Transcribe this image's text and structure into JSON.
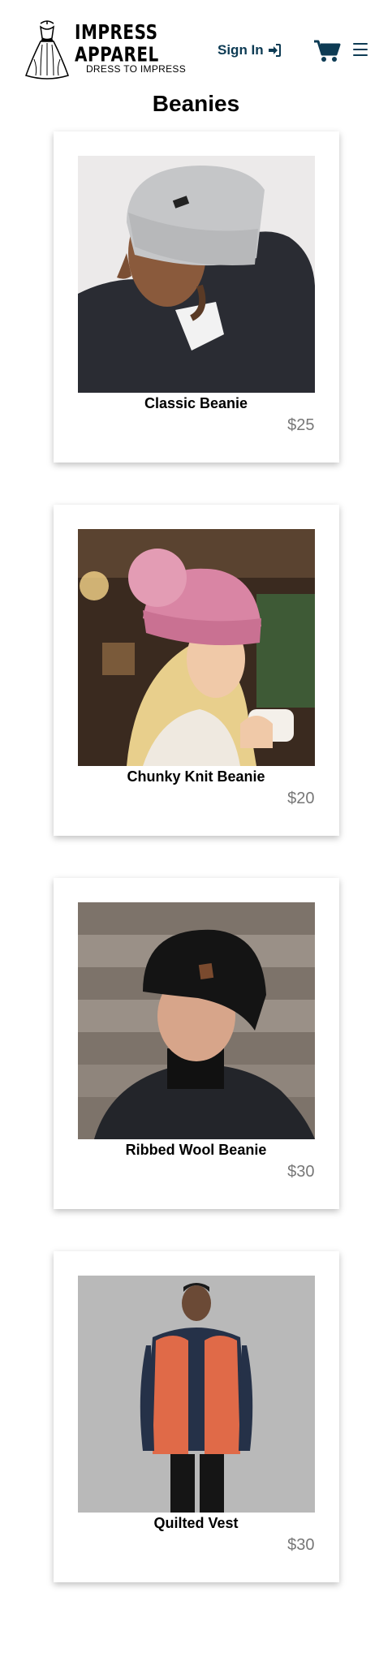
{
  "header": {
    "brand_name": "IMPRESS APPAREL",
    "brand_tagline": "DRESS TO IMPRESS",
    "signin_label": "Sign In",
    "brand_color": "#0d3b54"
  },
  "page": {
    "title": "Beanies"
  },
  "products": [
    {
      "name": "Classic Beanie",
      "price": "$25",
      "image_icon": "man-grey-beanie-photo"
    },
    {
      "name": "Chunky Knit Beanie",
      "price": "$20",
      "image_icon": "woman-pink-knit-beanie-photo"
    },
    {
      "name": "Ribbed Wool Beanie",
      "price": "$30",
      "image_icon": "man-black-beanie-photo"
    },
    {
      "name": "Quilted Vest",
      "price": "$30",
      "image_icon": "man-orange-vest-photo"
    }
  ]
}
